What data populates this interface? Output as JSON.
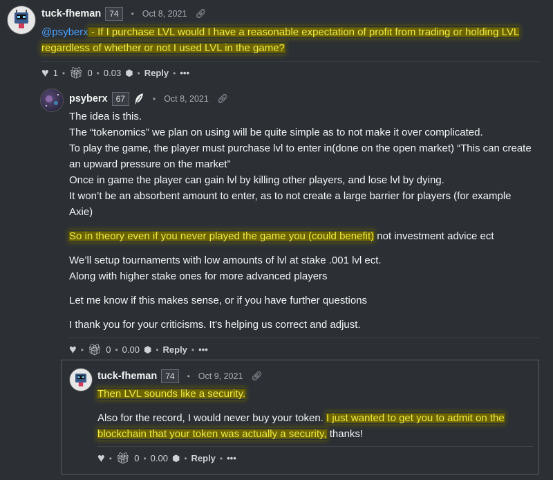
{
  "comments": [
    {
      "author": "tuck-fheman",
      "reputation": "74",
      "date": "Oct 8, 2021",
      "avatar_icon": "robot-avatar-icon",
      "mention": "@psyberx",
      "mention_sep": " - ",
      "body_highlight_1": "If I purchase LVL would I have a reasonable expectation of profit from trading or holding LVL",
      "body_highlight_2": "regardless of whether or not I used LVL in the game?",
      "votes": "1",
      "tips": "0",
      "payout": "0.03",
      "reply_label": "Reply",
      "more_label": "•••"
    },
    {
      "author": "psyberx",
      "reputation": "67",
      "date": "Oct 8, 2021",
      "avatar_icon": "space-avatar-icon",
      "badge_icon": "feather-icon",
      "lines": [
        "The idea is this.",
        "The “tokenomics” we plan on using will be quite simple as to not make it over complicated.",
        "To play the game, the player must purchase lvl to enter in(done on the open market) “This can create",
        "an upward pressure on the market”",
        "Once in game the player can gain lvl by killing other players, and lose lvl by dying.",
        "It won’t be an absorbent amount to enter, as to not create a large barrier for players (for example",
        "Axie)"
      ],
      "highlight_line": "So in theory even if you never played the game you (could benefit)",
      "highlight_line_rest": " not investment advice ect",
      "lines2": [
        "We’ll setup tournaments with low amounts of lvl at stake .001 lvl ect.",
        "Along with higher stake ones for more advanced players"
      ],
      "line3": "Let me know if this makes sense, or if you have further questions",
      "line4": "I thank you for your criticisms. It’s helping us correct and adjust.",
      "tips": "0",
      "payout": "0.00",
      "reply_label": "Reply",
      "more_label": "•••"
    },
    {
      "author": "tuck-fheman",
      "reputation": "74",
      "date": "Oct 9, 2021",
      "avatar_icon": "robot-avatar-icon",
      "highlight_1": "Then LVL sounds like a security.",
      "line2_plain": "Also for the record, I would never buy your token. ",
      "line2_highlight": "I just wanted to get you to admit on the",
      "line3_highlight": "blockchain that your token was actually a security,",
      "line3_plain": " thanks!",
      "tips": "0",
      "payout": "0.00",
      "reply_label": "Reply",
      "more_label": "•••"
    }
  ]
}
